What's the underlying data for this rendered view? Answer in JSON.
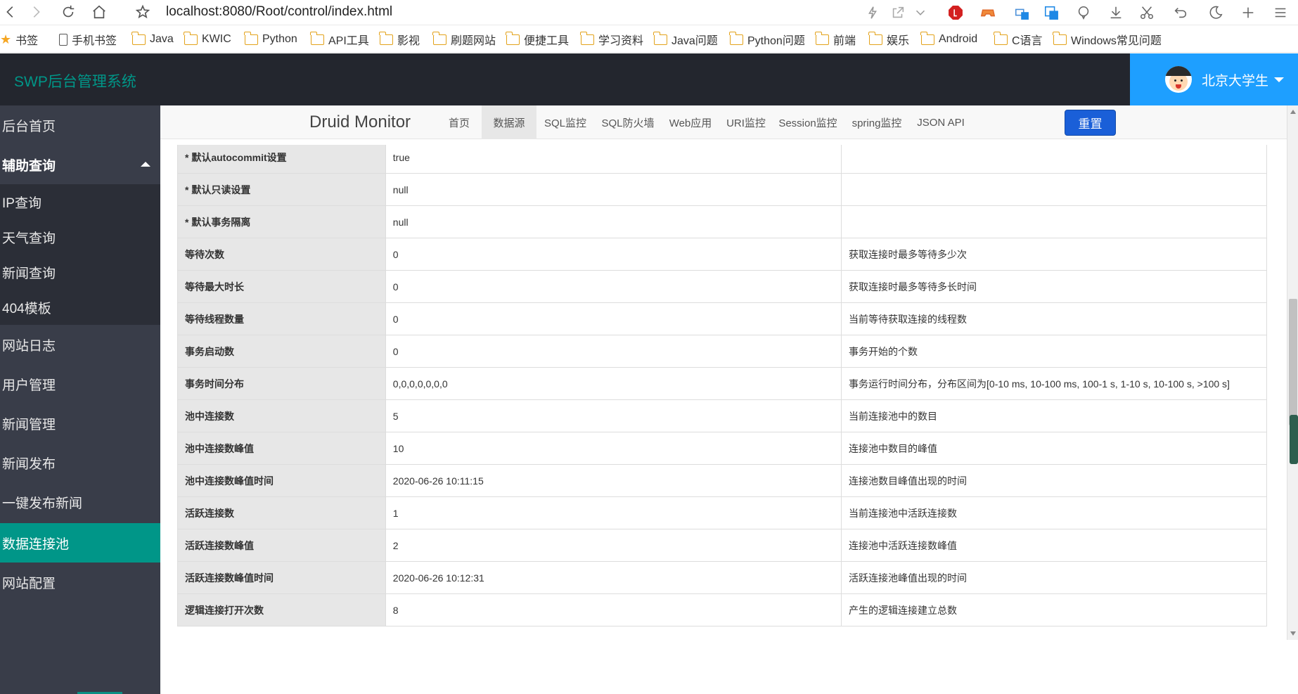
{
  "browser": {
    "url": "localhost:8080/Root/control/index.html"
  },
  "bookmarks": {
    "items": [
      {
        "label": "书签",
        "icon": "star-icon"
      },
      {
        "label": "手机书签",
        "icon": "phone-icon"
      },
      {
        "label": "Java",
        "icon": "folder-icon"
      },
      {
        "label": "KWIC",
        "icon": "folder-icon"
      },
      {
        "label": "Python",
        "icon": "folder-icon"
      },
      {
        "label": "API工具",
        "icon": "folder-icon"
      },
      {
        "label": "影视",
        "icon": "folder-icon"
      },
      {
        "label": "刷题网站",
        "icon": "folder-icon"
      },
      {
        "label": "便捷工具",
        "icon": "folder-icon"
      },
      {
        "label": "学习资料",
        "icon": "folder-icon"
      },
      {
        "label": "Java问题",
        "icon": "folder-icon"
      },
      {
        "label": "Python问题",
        "icon": "folder-icon"
      },
      {
        "label": "前端",
        "icon": "folder-icon"
      },
      {
        "label": "娱乐",
        "icon": "folder-icon"
      },
      {
        "label": "Android",
        "icon": "folder-icon"
      },
      {
        "label": "C语言",
        "icon": "folder-icon"
      },
      {
        "label": "Windows常见问题",
        "icon": "folder-icon"
      }
    ]
  },
  "app": {
    "title": "SWP后台管理系统",
    "user_name": "北京大学生"
  },
  "sidebar": {
    "home": "后台首页",
    "group_label": "辅助查询",
    "group_items": [
      "IP查询",
      "天气查询",
      "新闻查询",
      "404模板"
    ],
    "items": [
      "网站日志",
      "用户管理",
      "新闻管理",
      "新闻发布",
      "一键发布新闻",
      "数据连接池",
      "网站配置"
    ],
    "active": "数据连接池"
  },
  "druid": {
    "brand": "Druid Monitor",
    "tabs": [
      "首页",
      "数据源",
      "SQL监控",
      "SQL防火墙",
      "Web应用",
      "URI监控",
      "Session监控",
      "spring监控",
      "JSON API"
    ],
    "active_tab": "数据源",
    "reset_label": "重置"
  },
  "table": {
    "rows": [
      {
        "key": "* 默认autocommit设置",
        "value": "true",
        "desc": ""
      },
      {
        "key": "* 默认只读设置",
        "value": "null",
        "desc": ""
      },
      {
        "key": "* 默认事务隔离",
        "value": "null",
        "desc": ""
      },
      {
        "key": "等待次数",
        "value": "0",
        "desc": "获取连接时最多等待多少次"
      },
      {
        "key": "等待最大时长",
        "value": "0",
        "desc": "获取连接时最多等待多长时间"
      },
      {
        "key": "等待线程数量",
        "value": "0",
        "desc": "当前等待获取连接的线程数"
      },
      {
        "key": "事务启动数",
        "value": "0",
        "desc": "事务开始的个数"
      },
      {
        "key": "事务时间分布",
        "value": "0,0,0,0,0,0,0",
        "desc": "事务运行时间分布，分布区间为[0-10 ms, 10-100 ms, 100-1 s, 1-10 s, 10-100 s, >100 s]"
      },
      {
        "key": "池中连接数",
        "value": "5",
        "desc": "当前连接池中的数目"
      },
      {
        "key": "池中连接数峰值",
        "value": "10",
        "desc": "连接池中数目的峰值"
      },
      {
        "key": "池中连接数峰值时间",
        "value": "2020-06-26 10:11:15",
        "desc": "连接池数目峰值出现的时间"
      },
      {
        "key": "活跃连接数",
        "value": "1",
        "desc": "当前连接池中活跃连接数"
      },
      {
        "key": "活跃连接数峰值",
        "value": "2",
        "desc": "连接池中活跃连接数峰值"
      },
      {
        "key": "活跃连接数峰值时间",
        "value": "2020-06-26 10:12:31",
        "desc": "活跃连接池峰值出现的时间"
      },
      {
        "key": "逻辑连接打开次数",
        "value": "8",
        "desc": "产生的逻辑连接建立总数"
      }
    ]
  },
  "colors": {
    "header_bg": "#23262e",
    "sidebar_bg": "#393d49",
    "accent": "#009688",
    "user_bg": "#1e9fff",
    "reset_btn": "#1a5fd8"
  }
}
